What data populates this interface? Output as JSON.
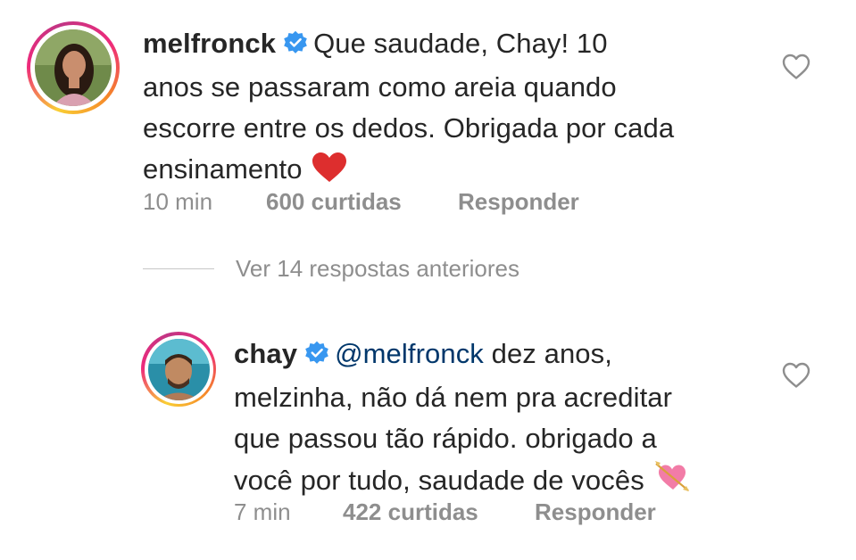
{
  "comments": [
    {
      "username": "melfronck",
      "text_line1": "Que saudade, Chay! 10",
      "text_line2": "anos se passaram como areia quando",
      "text_line3": "escorre entre os dedos. Obrigada por cada",
      "text_line4": "ensinamento",
      "emoji": "red-heart",
      "time": "10 min",
      "likes": "600 curtidas",
      "reply_label": "Responder"
    },
    {
      "username": "chay",
      "mention": "@melfronck",
      "text_line1_rest": "dez anos,",
      "text_line2": "melzinha, não dá nem pra acreditar",
      "text_line3": "que passou tão rápido. obrigado a",
      "text_line4": "você por tudo, saudade de vocês",
      "emoji": "heart-with-arrow",
      "time": "7 min",
      "likes": "422 curtidas",
      "reply_label": "Responder"
    }
  ],
  "view_replies": "Ver 14 respostas anteriores",
  "colors": {
    "text": "#262626",
    "meta": "#8e8e8e",
    "mention": "#00376b",
    "verified": "#3897f0"
  }
}
